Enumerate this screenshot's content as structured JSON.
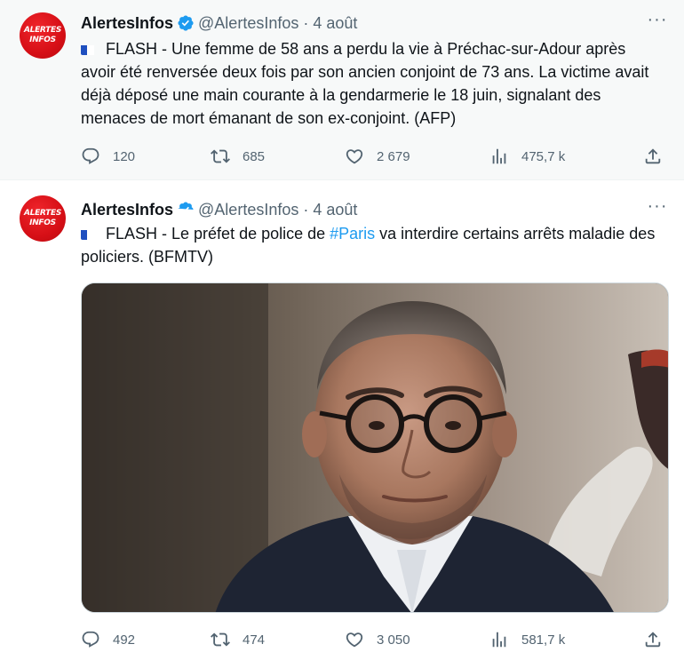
{
  "tweets": [
    {
      "author": {
        "name": "AlertesInfos",
        "handle": "@AlertesInfos",
        "avatar_text_line1": "ALERTES",
        "avatar_text_line2": "INFOS"
      },
      "date": "4 août",
      "separator": "·",
      "more_label": "···",
      "text": "FLASH - Une femme de 58 ans a perdu la vie à Préchac-sur-Adour après avoir été renversée deux fois par son ancien conjoint de 73 ans. La victime avait déjà déposé une main courante à la gendarmerie le 18 juin, signalant des menaces de mort émanant de son ex-conjoint. (AFP)",
      "stats": {
        "replies": "120",
        "retweets": "685",
        "likes": "2 679",
        "views": "475,7 k"
      }
    },
    {
      "author": {
        "name": "AlertesInfos",
        "handle": "@AlertesInfos",
        "avatar_text_line1": "ALERTES",
        "avatar_text_line2": "INFOS"
      },
      "date": "4 août",
      "separator": "·",
      "more_label": "···",
      "text_before": "FLASH - Le préfet de police de ",
      "hashtag": "#Paris",
      "text_after": " va interdire certains arrêts maladie des policiers. (BFMTV)",
      "stats": {
        "replies": "492",
        "retweets": "474",
        "likes": "3 050",
        "views": "581,7 k"
      }
    }
  ],
  "colors": {
    "accent": "#1d9bf0",
    "muted_text": "#536471",
    "avatar_red": "#d60f16",
    "highlight_bg": "#f7f9f9"
  },
  "icons": {
    "verified": "verified-badge-icon",
    "reply": "reply-icon",
    "retweet": "retweet-icon",
    "like": "heart-icon",
    "views": "views-icon",
    "share": "share-icon",
    "flag": "french-flag-icon"
  }
}
